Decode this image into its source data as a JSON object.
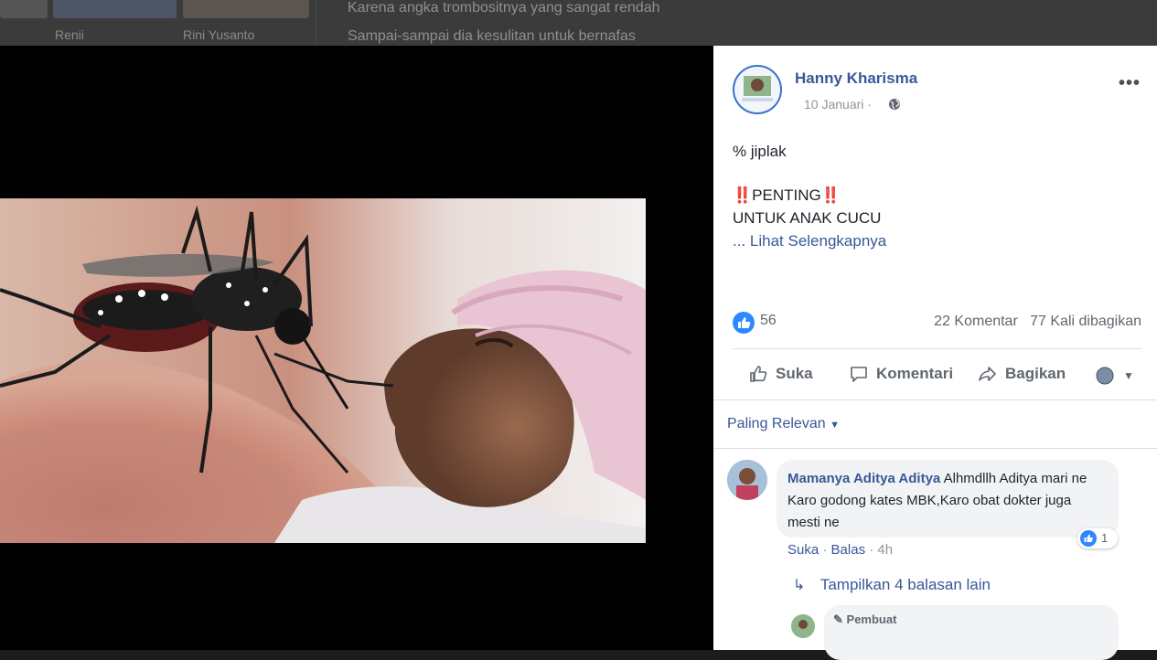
{
  "background_feed": {
    "friends": [
      {
        "name": "Renii"
      },
      {
        "name": "Rini Yusanto"
      }
    ],
    "post_lines": [
      "Karena angka trombositnya yang sangat rendah",
      "Sampai-sampai dia kesulitan untuk bernafas"
    ]
  },
  "photo": {
    "alt_subject": "mosquito-and-child-photo"
  },
  "post": {
    "author": "Hanny Kharisma",
    "date": "10 Januari",
    "separator": "·",
    "privacy_icon": "globe-icon",
    "line1": "% jiplak",
    "line2": "‼️PENTING‼️",
    "line3": "UNTUK ANAK CUCU",
    "see_more": "... Lihat Selengkapnya",
    "likes_count": "56",
    "comments_count": "22 Komentar",
    "shares_count": "77 Kali dibagikan"
  },
  "actions": {
    "like": "Suka",
    "comment": "Komentari",
    "share": "Bagikan"
  },
  "comments": {
    "sort_label": "Paling Relevan",
    "items": [
      {
        "author": "Mamanya Aditya Aditya",
        "text": "Alhmdllh Aditya mari ne Karo godong kates MBK,Karo obat dokter juga mesti ne",
        "likes": "1",
        "like_action": "Suka",
        "reply_action": "Balas",
        "time": "4h",
        "dot": "·"
      }
    ],
    "show_replies": "Tampilkan 4 balasan lain",
    "reply_badge": "Pembuat"
  },
  "colors": {
    "link": "#385898",
    "like_blue": "#2d88ff",
    "muted": "#606770"
  }
}
